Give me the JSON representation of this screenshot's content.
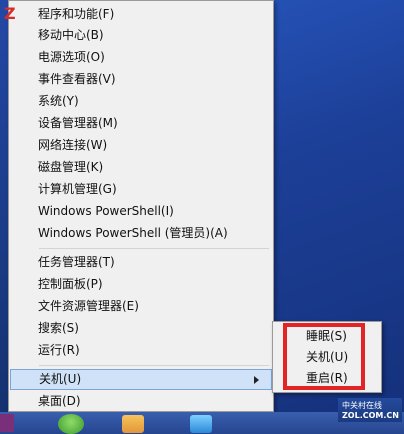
{
  "menu": {
    "groups": [
      [
        "程序和功能(F)",
        "移动中心(B)",
        "电源选项(O)",
        "事件查看器(V)",
        "系统(Y)",
        "设备管理器(M)",
        "网络连接(W)",
        "磁盘管理(K)",
        "计算机管理(G)",
        "Windows PowerShell(I)",
        "Windows PowerShell (管理员)(A)"
      ],
      [
        "任务管理器(T)",
        "控制面板(P)",
        "文件资源管理器(E)",
        "搜索(S)",
        "运行(R)"
      ],
      [
        "关机(U)",
        "桌面(D)"
      ]
    ]
  },
  "submenu": {
    "items": [
      "睡眠(S)",
      "关机(U)",
      "重启(R)"
    ]
  },
  "taskbar": {
    "app4_label": "Z",
    "app5_line1": "中关村在线",
    "app5_line2": "ZOL.COM.CN"
  },
  "colors": {
    "highlight_bg": "#cfe2f7",
    "highlight_border": "#7ba5d6",
    "annotation_red": "#e32424"
  }
}
